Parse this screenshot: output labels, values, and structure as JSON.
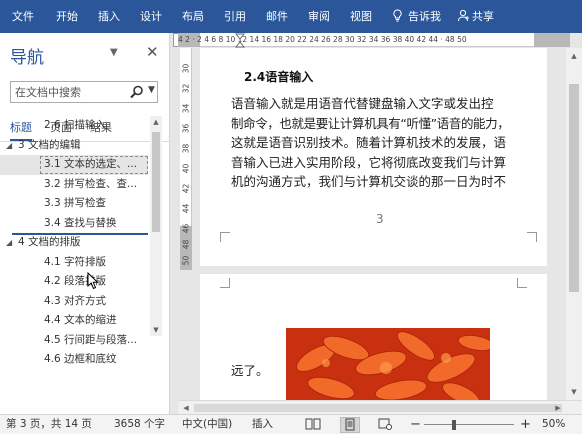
{
  "ribbon": {
    "tabs": [
      "文件",
      "开始",
      "插入",
      "设计",
      "布局",
      "引用",
      "邮件",
      "审阅",
      "视图"
    ],
    "tell_me": "告诉我",
    "share": "共享"
  },
  "nav": {
    "title": "导航",
    "search_placeholder": "在文档中搜索",
    "tabs": [
      "标题",
      "页面",
      "结果"
    ],
    "tree": [
      {
        "label": "2.6 扫描输入",
        "level": 2
      },
      {
        "label": "3 文档的编辑",
        "level": 1,
        "expanded": true
      },
      {
        "label": "3.1 文本的选定、...",
        "level": 2,
        "selected": true
      },
      {
        "label": "3.2 拼写检查、查...",
        "level": 2
      },
      {
        "label": "3.3 拼写检查",
        "level": 2
      },
      {
        "label": "3.4 查找与替换",
        "level": 2
      },
      {
        "label": "4 文档的排版",
        "level": 1,
        "expanded": true
      },
      {
        "label": "4.1 字符排版",
        "level": 2
      },
      {
        "label": "4.2 段落排版",
        "level": 2
      },
      {
        "label": "4.3 对齐方式",
        "level": 2
      },
      {
        "label": "4.4 文本的缩进",
        "level": 2
      },
      {
        "label": "4.5 行间距与段落...",
        "level": 2
      },
      {
        "label": "4.6 边框和底纹",
        "level": 2
      }
    ]
  },
  "ruler": {
    "h_ticks": "4   2   ·   2   4   6   8   10  12  14  16  18  20  22  24  26  28  30  32  34  36  38  40  42  44  ·  48  50",
    "v_ticks": [
      "30",
      "32",
      "34",
      "36",
      "38",
      "40",
      "42",
      "44",
      "46",
      "48",
      "50"
    ]
  },
  "document": {
    "heading": "2.4语音输入",
    "paragraph_lines": [
      "语音输入就是用语音代替键盘输入文字或发出控",
      "制命令，也就是要让计算机具有“听懂”语音的能力，",
      "这就是语音识别技术。随着计算机技术的发展，语",
      "音输入已进入实用阶段，它将彻底改变我们与计算",
      "机的沟通方式，我们与计算机交谈的那一日为时不"
    ],
    "page_number": "3",
    "page2_text": "远了。"
  },
  "status": {
    "page": "第 3 页，共 14 页",
    "words": "3658 个字",
    "language": "中文(中国)",
    "mode": "插入",
    "zoom": "50%",
    "zoom_value": 0.5
  },
  "colors": {
    "ribbon": "#2b579a",
    "accent": "#2b579a",
    "flower": "#e8461c"
  }
}
